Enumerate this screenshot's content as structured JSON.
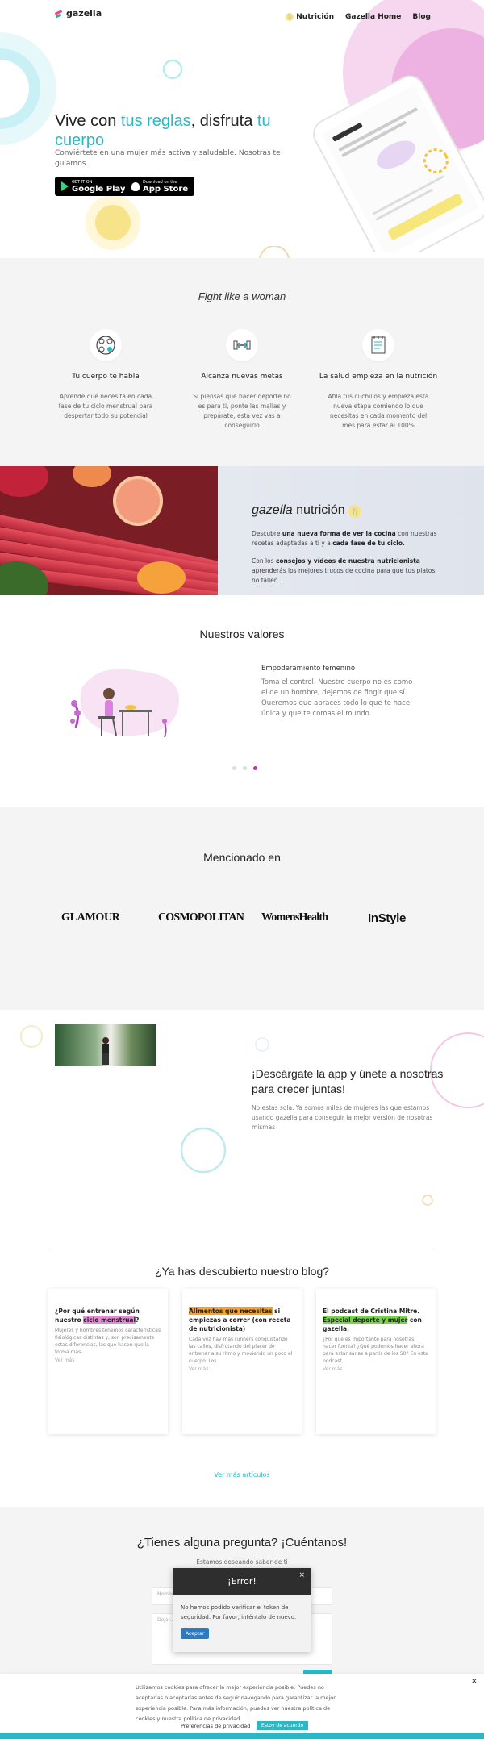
{
  "header": {
    "logo_text": "gazella",
    "nav": [
      "Nutrición",
      "Gazella Home",
      "Blog"
    ]
  },
  "hero": {
    "title_part1": "Vive con ",
    "title_accent1": "tus reglas",
    "title_part2": ", disfruta ",
    "title_accent2": "tu cuerpo",
    "subtitle": "Conviértete en una mujer más activa y saludable. Nosotras te guiamos.",
    "google_play_small": "GET IT ON",
    "google_play_big": "Google Play",
    "app_store_small": "Download on the",
    "app_store_big": "App Store"
  },
  "features": {
    "title": "Fight like a woman",
    "items": [
      {
        "icon": "cycle-icon",
        "title": "Tu cuerpo te habla",
        "text": "Aprende qué necesita en cada fase de tu ciclo menstrual para despertar todo su potencial"
      },
      {
        "icon": "dumbbell-icon",
        "title": "Alcanza nuevas metas",
        "text": "Si piensas que hacer deporte no es para ti, ponte las mallas y prepárate, esta vez vas a conseguirlo"
      },
      {
        "icon": "notepad-icon",
        "title": "La salud empieza en la nutrición",
        "text": "Afila tus cuchillos y empieza esta nueva etapa comiendo lo que necesitas en cada momento del mes para estar al 100%"
      }
    ]
  },
  "nutrition": {
    "title_italic": "gazella",
    "title_rest": " nutrición",
    "p1_a": "Descubre ",
    "p1_b": "una nueva forma de ver la cocina",
    "p1_c": " con nuestras recetas adaptadas a ti y a ",
    "p1_d": "cada fase de tu ciclo.",
    "p2_a": "Con los ",
    "p2_b": "consejos y vídeos de nuestra nutricionista",
    "p2_c": " aprenderás los mejores trucos de cocina para que tus platos no fallen."
  },
  "values": {
    "title": "Nuestros valores",
    "item_title": "Empoderamiento femenino",
    "item_text": "Toma el control. Nuestro cuerpo no es como el de un hombre, dejemos de fingir que sí. Queremos que abraces todo lo que te hace única y que te comas el mundo."
  },
  "press": {
    "title": "Mencionado en",
    "logos": [
      "GLAMOUR",
      "COSMOPOLITAN",
      "WomensHealth",
      "InStyle"
    ]
  },
  "download": {
    "title": "¡Descárgate la app y únete a nosotras para crecer juntas!",
    "text": "No estás sola. Ya somos miles de mujeres las que estamos usando gazella para conseguir la mejor versión de nosotras mismas"
  },
  "blog": {
    "title": "¿Ya has descubierto nuestro blog?",
    "cards": [
      {
        "pre": "¿Por qué entrenar según nuestro ",
        "hl": "ciclo menstrual",
        "post": "?",
        "text": "Mujeres y hombres tenemos características fisiológicas distintas y, son precisamente estas diferencias, las que hacen que la forma mas",
        "more": "Ver más"
      },
      {
        "pre": "",
        "hl": "Alimentos que necesitas",
        "post": " si empiezas a correr (con receta de nutricionista)",
        "text": "Cada vez hay más runners conquistando las calles, disfrutando del placer de entrenar a su ritmo y moviendo un poco el cuerpo. Los",
        "more": "Ver más"
      },
      {
        "pre": "El podcast de Cristina Mitre. ",
        "hl": "Especial deporte y mujer",
        "post": " con gazella.",
        "text": "¿Por qué es importante para nosotras hacer fuerza? ¿Qué podemos hacer ahora para estar sanas a partir de los 50? En este podcast,",
        "more": "Ver más"
      }
    ],
    "more_link": "Ver más artículos"
  },
  "contact": {
    "title": "¿Tienes alguna pregunta? ¡Cuéntanos!",
    "subtitle": "Estamos deseando saber de ti",
    "name_placeholder": "Nombre",
    "message_placeholder": "Dejar..."
  },
  "modal": {
    "title": "¡Error!",
    "close": "×",
    "body": "No hemos podido verificar el token de seguridad. Por favor, inténtalo de nuevo.",
    "button": "Aceptar"
  },
  "cookie": {
    "close": "×",
    "text": "Utilizamos cookies para ofrecer la mejor experiencia posible. Puedes no aceptarlas o aceptarlas antes de seguir navegando para garantizar la mejor experiencia posible. Para más información, puedes ver nuestra política de cookies y nuestra política de privacidad",
    "preferences": "Preferencias de privacidad",
    "accept": "Estoy de acuerdo"
  },
  "colors": {
    "accent": "#2bb8c4",
    "pink": "#e88ad9",
    "dark": "#2e2e2e"
  }
}
